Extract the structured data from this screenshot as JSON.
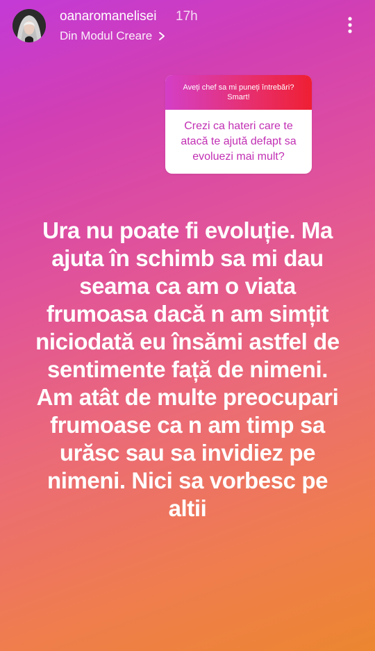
{
  "story": {
    "username": "oanaromanelisei",
    "time_ago": "17h",
    "source_label": "Din Modul Creare",
    "question_prompt": "Aveți chef sa mi puneți întrebări? Smart!",
    "question": "Crezi ca hateri care te atacă te ajută defapt sa evoluezi mai mult?",
    "answer_text": "Ura nu poate fi evoluție. Ma ajuta în schimb sa mi dau seama ca am o viata frumoasa dacă n am simțit niciodată eu însămi astfel de sentimente față de nimeni. Am atât de multe preocupari frumoase ca n am timp sa urăsc sau sa invidiez pe nimeni. Nici sa vorbesc pe altii"
  },
  "icons": {
    "profile": "avatar",
    "creation_mode": "chevron-right-icon",
    "more": "vertical-dots-icon"
  },
  "colors": {
    "gradient_top": "#c33ad6",
    "gradient_bottom": "#ec8630",
    "question_accent": "#c12fb3",
    "white": "#ffffff"
  }
}
